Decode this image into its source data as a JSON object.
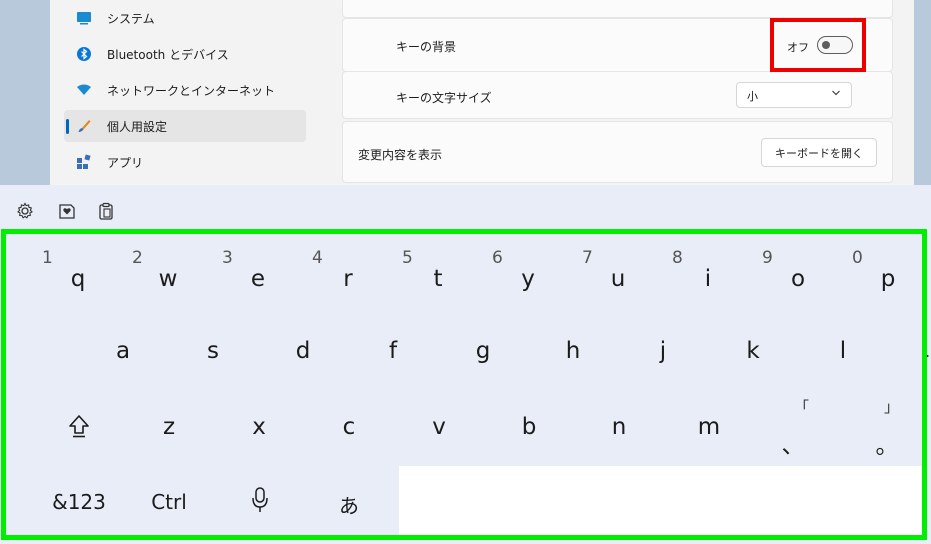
{
  "sidebar": {
    "items": [
      {
        "label": "システム",
        "icon": "monitor-icon"
      },
      {
        "label": "Bluetooth とデバイス",
        "icon": "bluetooth-icon"
      },
      {
        "label": "ネットワークとインターネット",
        "icon": "wifi-icon"
      },
      {
        "label": "個人用設定",
        "icon": "brush-icon",
        "active": true
      },
      {
        "label": "アプリ",
        "icon": "apps-icon"
      }
    ]
  },
  "settings": {
    "key_background_label": "キーの背景",
    "key_background_state": "オフ",
    "key_text_size_label": "キーの文字サイズ",
    "key_text_size_value": "小",
    "preview_label": "変更内容を表示",
    "open_keyboard_button": "キーボードを開く"
  },
  "keyboard": {
    "row1": [
      {
        "num": "1",
        "ch": "q"
      },
      {
        "num": "2",
        "ch": "w"
      },
      {
        "num": "3",
        "ch": "e"
      },
      {
        "num": "4",
        "ch": "r"
      },
      {
        "num": "5",
        "ch": "t"
      },
      {
        "num": "6",
        "ch": "y"
      },
      {
        "num": "7",
        "ch": "u"
      },
      {
        "num": "8",
        "ch": "i"
      },
      {
        "num": "9",
        "ch": "o"
      },
      {
        "num": "0",
        "ch": "p"
      }
    ],
    "row2": [
      "a",
      "s",
      "d",
      "f",
      "g",
      "h",
      "j",
      "k",
      "l"
    ],
    "row3": [
      "z",
      "x",
      "c",
      "v",
      "b",
      "n",
      "m"
    ],
    "row3_punct1": {
      "top": "「",
      "main": "、"
    },
    "row3_punct2": {
      "top": "」",
      "main": "。"
    },
    "row4": {
      "symbols": "&123",
      "ctrl": "Ctrl",
      "kana": "あ"
    },
    "trailing_mark": "."
  },
  "colors": {
    "highlight_red": "#ee0000",
    "highlight_green": "#00ee00",
    "accent": "#0067c0"
  }
}
